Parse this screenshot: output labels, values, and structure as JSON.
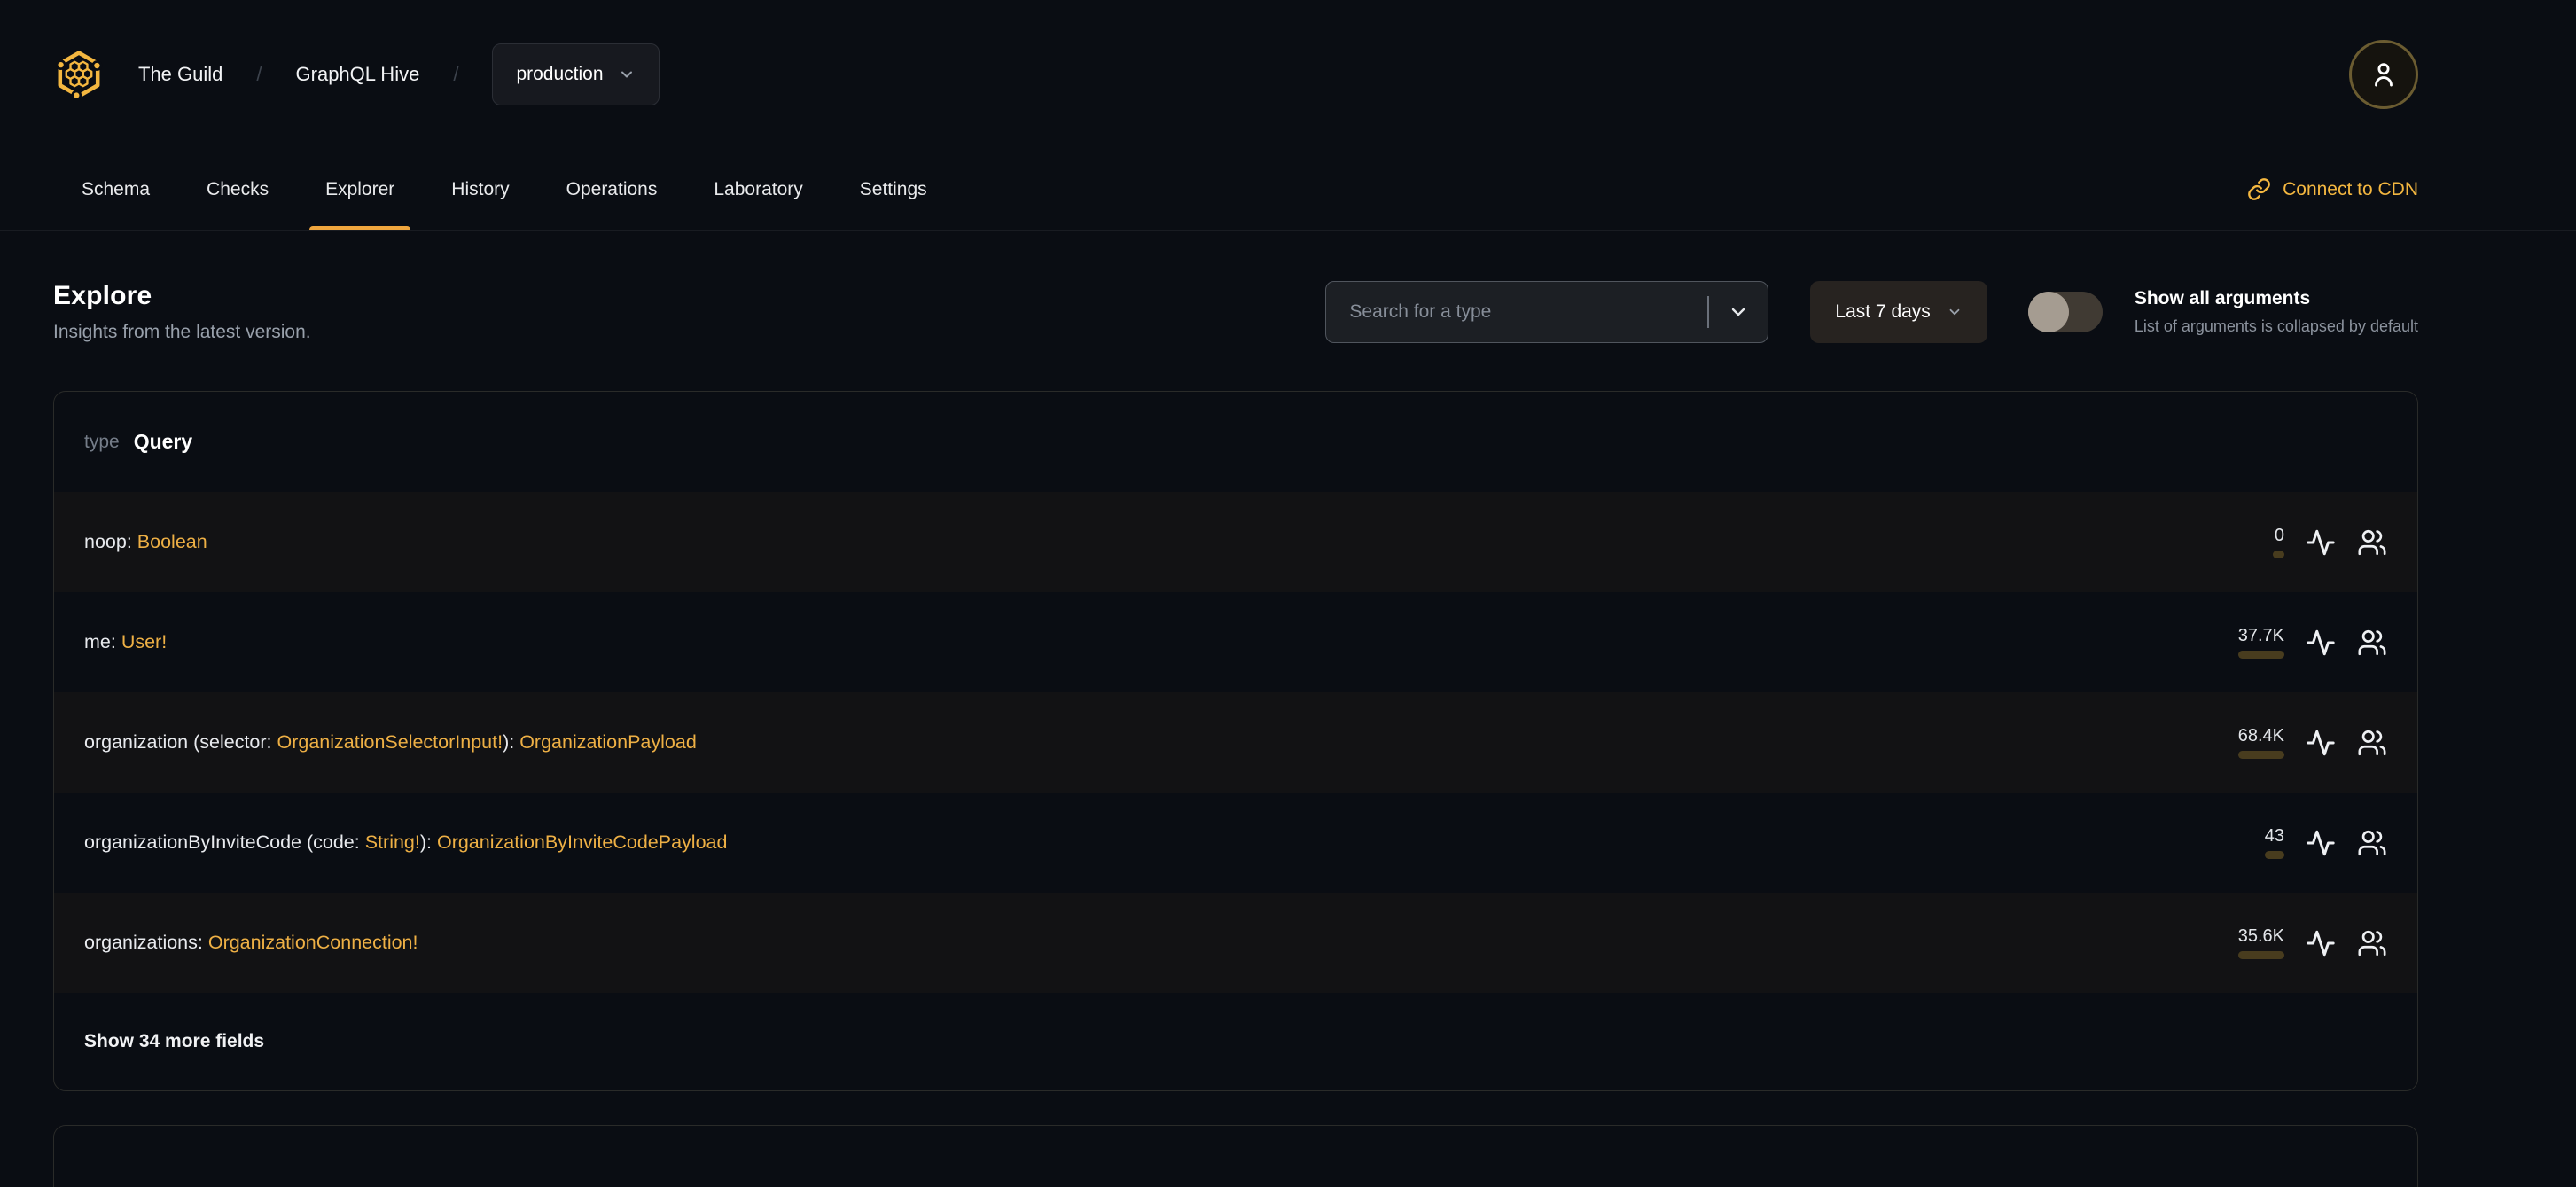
{
  "header": {
    "org": "The Guild",
    "separator": "/",
    "project": "GraphQL Hive",
    "target_selector": {
      "value": "production",
      "icon": "chevron-down-icon"
    },
    "logo_icon": "hive-honeycomb-logo",
    "avatar_icon": "user-icon"
  },
  "tabs": {
    "items": [
      {
        "label": "Schema"
      },
      {
        "label": "Checks"
      },
      {
        "label": "Explorer"
      },
      {
        "label": "History"
      },
      {
        "label": "Operations"
      },
      {
        "label": "Laboratory"
      },
      {
        "label": "Settings"
      }
    ],
    "active": "Explorer",
    "cdn_link": {
      "label": "Connect to CDN",
      "icon": "link-icon"
    }
  },
  "page": {
    "title": "Explore",
    "subtitle": "Insights from the latest version."
  },
  "controls": {
    "type_search": {
      "placeholder": "Search for a type",
      "icon": "chevron-down-icon"
    },
    "period": {
      "value": "Last 7 days",
      "icon": "chevron-down-icon"
    },
    "arguments_toggle": {
      "state": "off",
      "label": "Show all arguments",
      "description": "List of arguments is collapsed by default"
    }
  },
  "card": {
    "kind_keyword": "type",
    "type_name": "Query",
    "rows": [
      {
        "parts": [
          {
            "text": "noop: ",
            "kind": "plain"
          },
          {
            "text": "Boolean",
            "kind": "type"
          }
        ],
        "count": "0",
        "fill_pct": 0
      },
      {
        "parts": [
          {
            "text": "me: ",
            "kind": "plain"
          },
          {
            "text": "User!",
            "kind": "type"
          }
        ],
        "count": "37.7K",
        "fill_pct": 9
      },
      {
        "parts": [
          {
            "text": "organization (selector: ",
            "kind": "plain"
          },
          {
            "text": "OrganizationSelectorInput!",
            "kind": "type"
          },
          {
            "text": "): ",
            "kind": "plain"
          },
          {
            "text": "OrganizationPayload",
            "kind": "type"
          }
        ],
        "count": "68.4K",
        "fill_pct": 13
      },
      {
        "parts": [
          {
            "text": "organizationByInviteCode (code: ",
            "kind": "plain"
          },
          {
            "text": "String!",
            "kind": "type"
          },
          {
            "text": "): ",
            "kind": "plain"
          },
          {
            "text": "OrganizationByInviteCodePayload",
            "kind": "type"
          }
        ],
        "count": "43",
        "fill_pct": 0
      },
      {
        "parts": [
          {
            "text": "organizations: ",
            "kind": "plain"
          },
          {
            "text": "OrganizationConnection!",
            "kind": "type"
          }
        ],
        "count": "35.6K",
        "fill_pct": 9
      }
    ],
    "row_icons": [
      "activity-icon",
      "users-icon"
    ],
    "show_more_label": "Show 34 more fields"
  },
  "colors": {
    "accent": "#f4b740",
    "type_link": "#eeb045",
    "background": "#0a0d13",
    "row_alt": "#121214",
    "bar_track": "#483c1e",
    "bar_fill": "#f5b63c",
    "tab_underline": "#f0a63e"
  }
}
